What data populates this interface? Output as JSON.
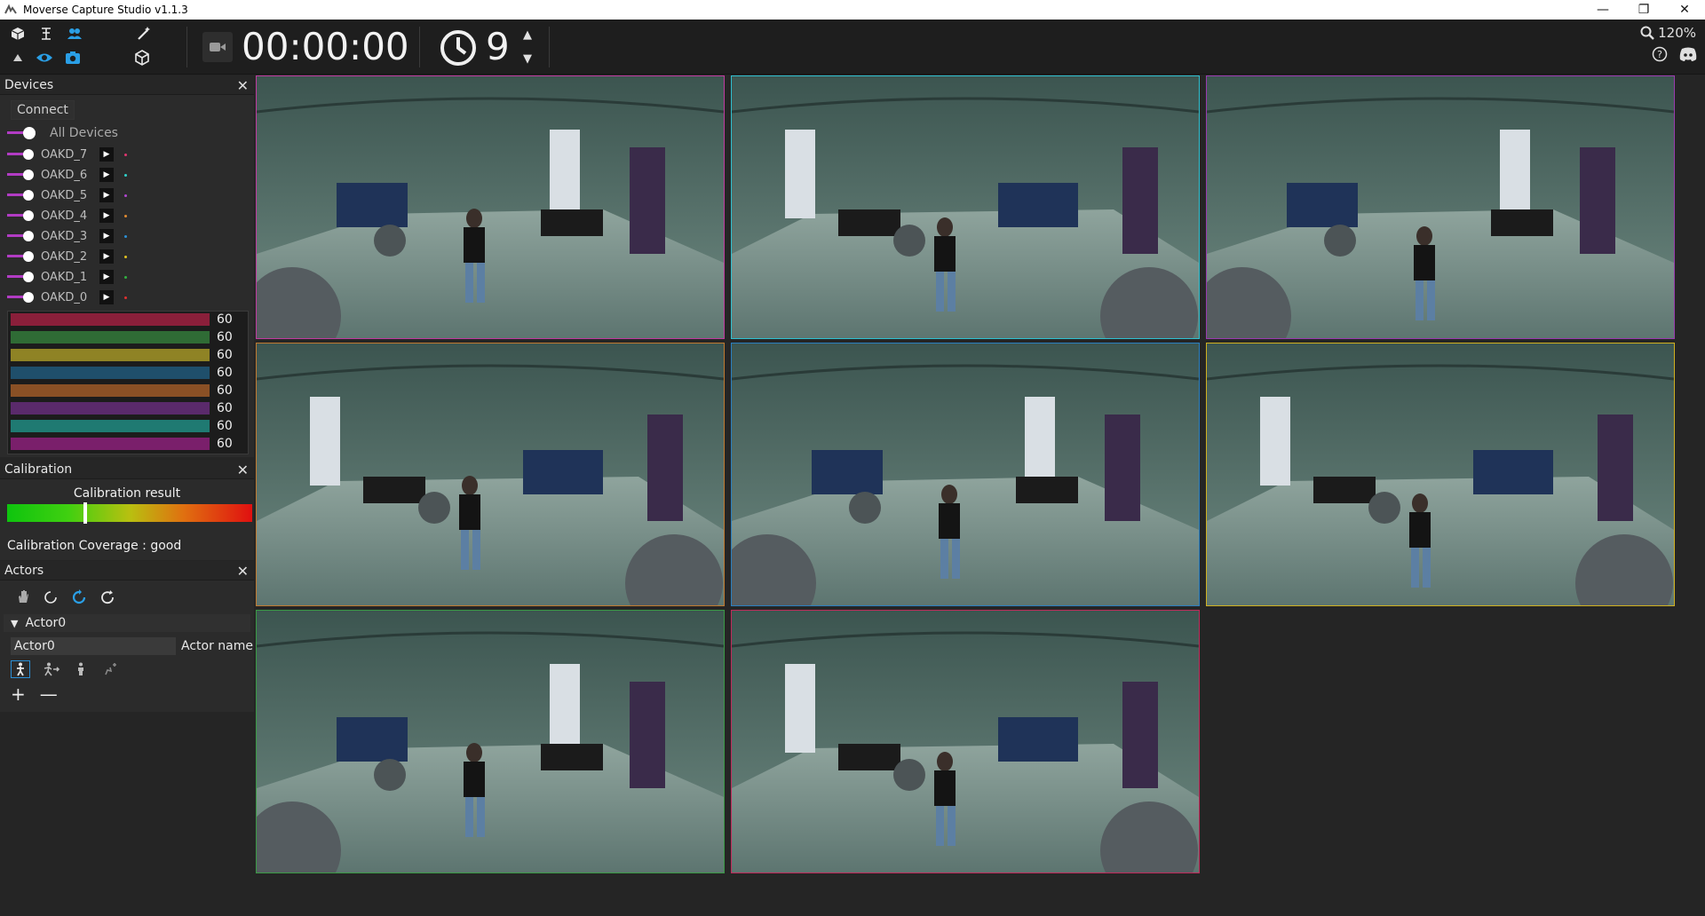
{
  "window": {
    "title": "Moverse Capture Studio v1.1.3",
    "controls": {
      "minimize": "—",
      "restore": "❐",
      "close": "✕"
    }
  },
  "toolbar": {
    "timecode": "00:00:00",
    "countdown": "9",
    "zoom": "120%"
  },
  "devices_panel": {
    "title": "Devices",
    "connect_label": "Connect",
    "all_devices_label": "All Devices",
    "devices": [
      {
        "name": "OAKD_7",
        "color": "#e0356f"
      },
      {
        "name": "OAKD_6",
        "color": "#2fd0c8"
      },
      {
        "name": "OAKD_5",
        "color": "#b046d0"
      },
      {
        "name": "OAKD_4",
        "color": "#e08a30"
      },
      {
        "name": "OAKD_3",
        "color": "#2a8fd6"
      },
      {
        "name": "OAKD_2",
        "color": "#e0c020"
      },
      {
        "name": "OAKD_1",
        "color": "#30b040"
      },
      {
        "name": "OAKD_0",
        "color": "#e03030"
      }
    ],
    "fps": [
      {
        "value": "60",
        "color": "#8a1f3a"
      },
      {
        "value": "60",
        "color": "#2f6b35"
      },
      {
        "value": "60",
        "color": "#8f8325"
      },
      {
        "value": "60",
        "color": "#1f4f6b"
      },
      {
        "value": "60",
        "color": "#8a5025"
      },
      {
        "value": "60",
        "color": "#5a2a6b"
      },
      {
        "value": "60",
        "color": "#1f7a72"
      },
      {
        "value": "60",
        "color": "#7a1f6b"
      }
    ]
  },
  "calibration_panel": {
    "title": "Calibration",
    "result_label": "Calibration result",
    "result_level": 0.32,
    "coverage_text": "Calibration Coverage : good"
  },
  "actors_panel": {
    "title": "Actors",
    "actor_header": "Actor0",
    "actor_name_value": "Actor0",
    "actor_name_label": "Actor name",
    "add_label": "+",
    "remove_label": "—"
  },
  "cameras": [
    {
      "name": "OAKD_7",
      "border": "#c03aa0"
    },
    {
      "name": "OAKD_6",
      "border": "#2fc0d0"
    },
    {
      "name": "OAKD_5",
      "border": "#9a3ab0"
    },
    {
      "name": "OAKD_4",
      "border": "#c07a30"
    },
    {
      "name": "OAKD_3",
      "border": "#2a7fc0"
    },
    {
      "name": "OAKD_2",
      "border": "#d0b020"
    },
    {
      "name": "OAKD_1",
      "border": "#3a9a45"
    },
    {
      "name": "OAKD_0",
      "border": "#c02a5a"
    }
  ]
}
